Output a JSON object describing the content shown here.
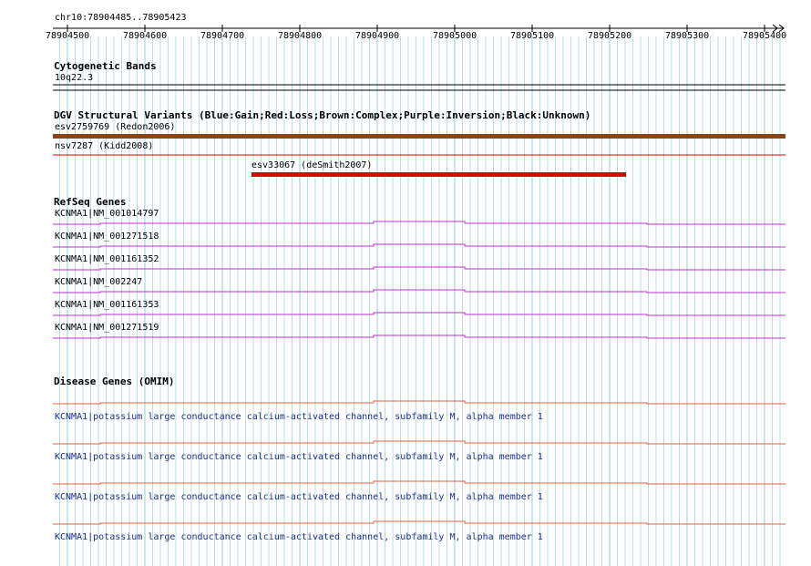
{
  "colors": {
    "grid": "#a7d4e7",
    "cnv_brown": "#8b4513",
    "cnv_red": "#e00000",
    "refseq_magenta": "#bb33cc",
    "omim_orange": "#e06040",
    "omim_text": "#1b2f8c"
  },
  "ruler": {
    "region": "chr10:78904485..78905423",
    "ticks": [
      "78904500",
      "78904600",
      "78904700",
      "78904800",
      "78904900",
      "78905000",
      "78905100",
      "78905200",
      "78905300",
      "78905400"
    ]
  },
  "tracks": {
    "cytoband": {
      "title": "Cytogenetic Bands",
      "band": "10q22.3"
    },
    "dgv": {
      "title": "DGV Structural Variants (Blue:Gain;Red:Loss;Brown:Complex;Purple:Inversion;Black:Unknown)",
      "variants": [
        {
          "label": "esv2759769 (Redon2006)",
          "type": "Complex"
        },
        {
          "label": "nsv7287 (Kidd2008)",
          "type": "Loss"
        },
        {
          "label": "esv33067 (deSmith2007)",
          "type": "Loss"
        }
      ]
    },
    "refseq": {
      "title": "RefSeq Genes",
      "genes": [
        "KCNMA1|NM_001014797",
        "KCNMA1|NM_001271518",
        "KCNMA1|NM_001161352",
        "KCNMA1|NM_002247",
        "KCNMA1|NM_001161353",
        "KCNMA1|NM_001271519"
      ]
    },
    "omim": {
      "title": "Disease Genes (OMIM)",
      "entries": [
        "KCNMA1|potassium large conductance calcium-activated channel, subfamily M, alpha member 1",
        "KCNMA1|potassium large conductance calcium-activated channel, subfamily M, alpha member 1",
        "KCNMA1|potassium large conductance calcium-activated channel, subfamily M, alpha member 1",
        "KCNMA1|potassium large conductance calcium-activated channel, subfamily M, alpha member 1"
      ]
    }
  }
}
